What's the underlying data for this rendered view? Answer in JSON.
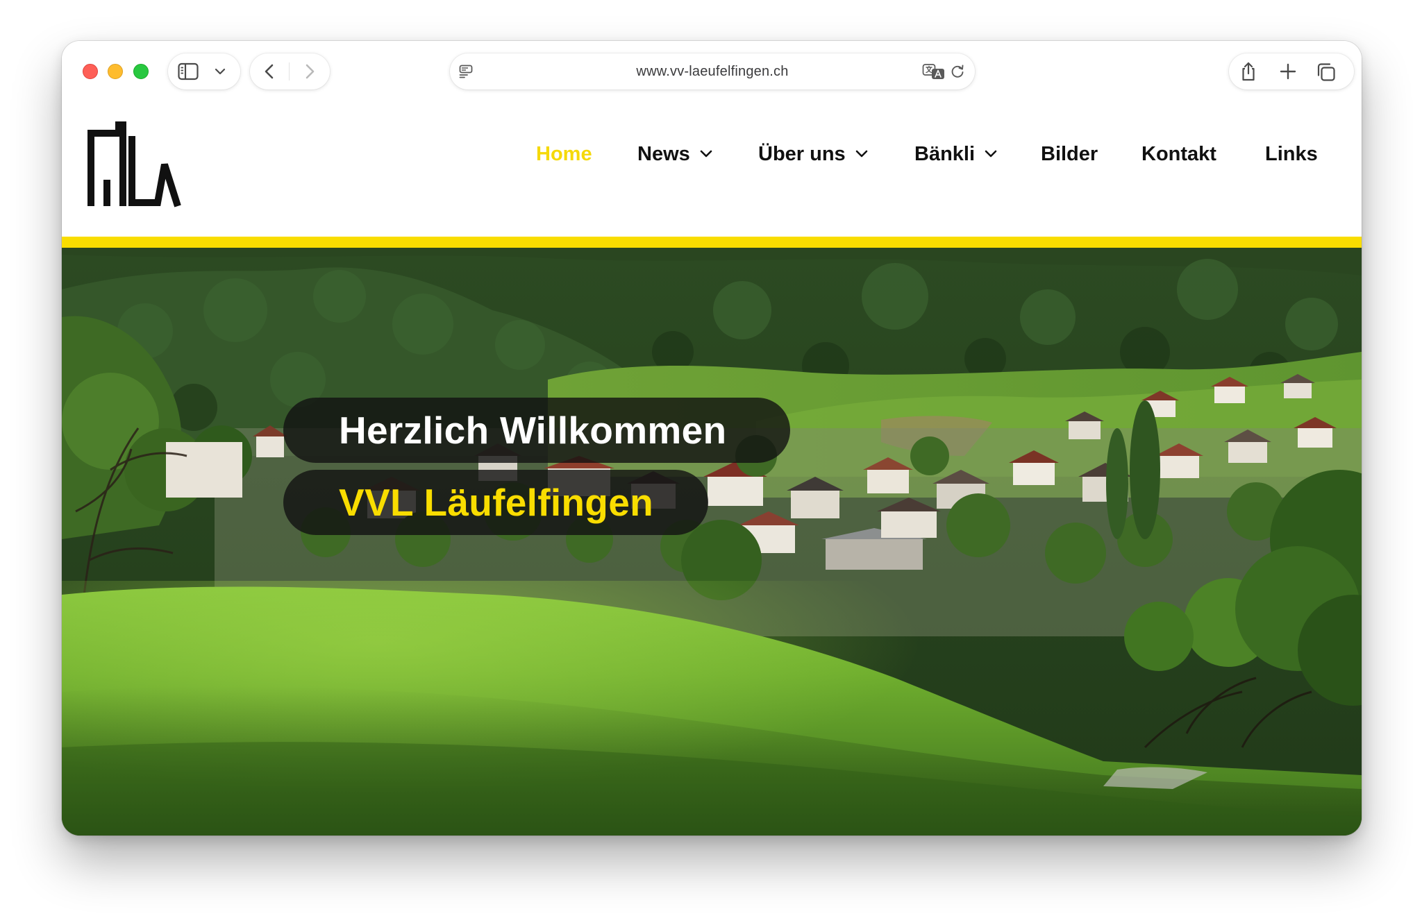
{
  "browser": {
    "url": "www.vv-laeufelfingen.ch",
    "icons": [
      "sidebar-icon",
      "chevron-down-icon",
      "back-icon",
      "forward-icon",
      "reader-icon",
      "translate-icon",
      "reload-icon",
      "share-icon",
      "new-tab-icon",
      "tab-overview-icon"
    ]
  },
  "site": {
    "logo_icon": "vvl-logo-icon",
    "nav": [
      {
        "label": "Home",
        "active": true
      },
      {
        "label": "News",
        "has_dropdown": true
      },
      {
        "label": "Über uns",
        "has_dropdown": true
      },
      {
        "label": "Bänkli",
        "has_dropdown": true
      },
      {
        "label": "Bilder"
      },
      {
        "label": "Kontakt"
      },
      {
        "label": "Links"
      }
    ]
  },
  "hero": {
    "greeting": "Herzlich Willkommen",
    "org_name": "VVL Läufelfingen"
  },
  "colors": {
    "accent": "#f9dd00",
    "active_nav": "#f5d90a",
    "text": "#111111",
    "caption_bg": "#121212"
  }
}
